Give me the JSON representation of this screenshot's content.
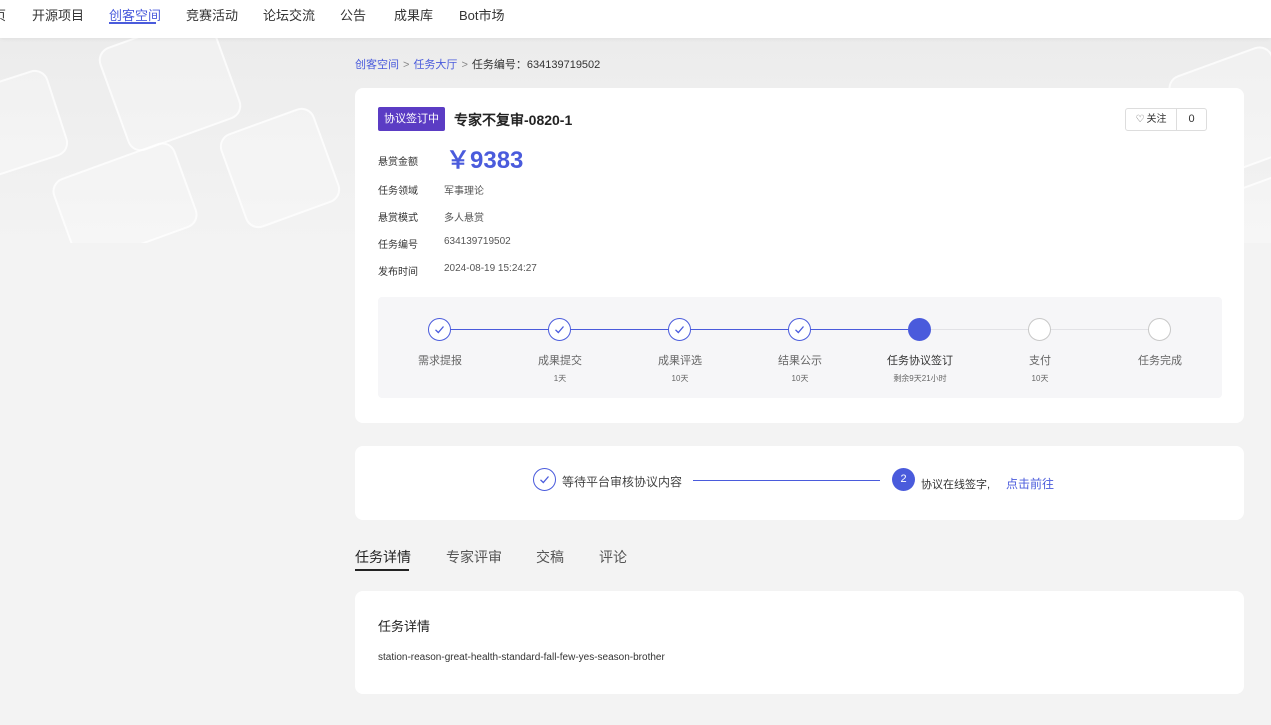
{
  "nav": {
    "partial_first": "页",
    "items": [
      "开源项目",
      "创客空间",
      "竞赛活动",
      "论坛交流",
      "公告",
      "成果库",
      "Bot市场"
    ],
    "active": "创客空间"
  },
  "breadcrumb": {
    "level1": "创客空间",
    "level2": "任务大厅",
    "current": "任务编号：634139719502"
  },
  "task": {
    "status_badge": "协议签订中",
    "title": "专家不复审-0820-1",
    "follow_label": "关注",
    "follow_count": "0",
    "reward_label": "悬赏金额",
    "reward_value": "￥9383",
    "fields": [
      {
        "label": "任务领域",
        "value": "军事理论"
      },
      {
        "label": "悬赏模式",
        "value": "多人悬赏"
      },
      {
        "label": "任务编号",
        "value": "634139719502"
      },
      {
        "label": "发布时间",
        "value": "2024-08-19 15:24:27"
      }
    ]
  },
  "steps": [
    {
      "label": "需求提报",
      "sub": "",
      "state": "done"
    },
    {
      "label": "成果提交",
      "sub": "1天",
      "state": "done"
    },
    {
      "label": "成果评选",
      "sub": "10天",
      "state": "done"
    },
    {
      "label": "结果公示",
      "sub": "10天",
      "state": "done"
    },
    {
      "label": "任务协议签订",
      "sub": "剩余9天21小时",
      "state": "current"
    },
    {
      "label": "支付",
      "sub": "10天",
      "state": "pending"
    },
    {
      "label": "任务完成",
      "sub": "",
      "state": "pending"
    }
  ],
  "agreement": {
    "step1_text": "等待平台审核协议内容",
    "step2_number": "2",
    "step2_text": "协议在线签字,",
    "step2_link": "点击前往"
  },
  "tabs": [
    "任务详情",
    "专家评审",
    "交稿",
    "评论"
  ],
  "active_tab": "任务详情",
  "details": {
    "title": "任务详情",
    "text": "station-reason-great-health-standard-fall-few-yes-season-brother"
  },
  "colors": {
    "accent": "#4a5bdc",
    "badge": "#5b3cc4",
    "page_bg": "#f3f3f3"
  }
}
